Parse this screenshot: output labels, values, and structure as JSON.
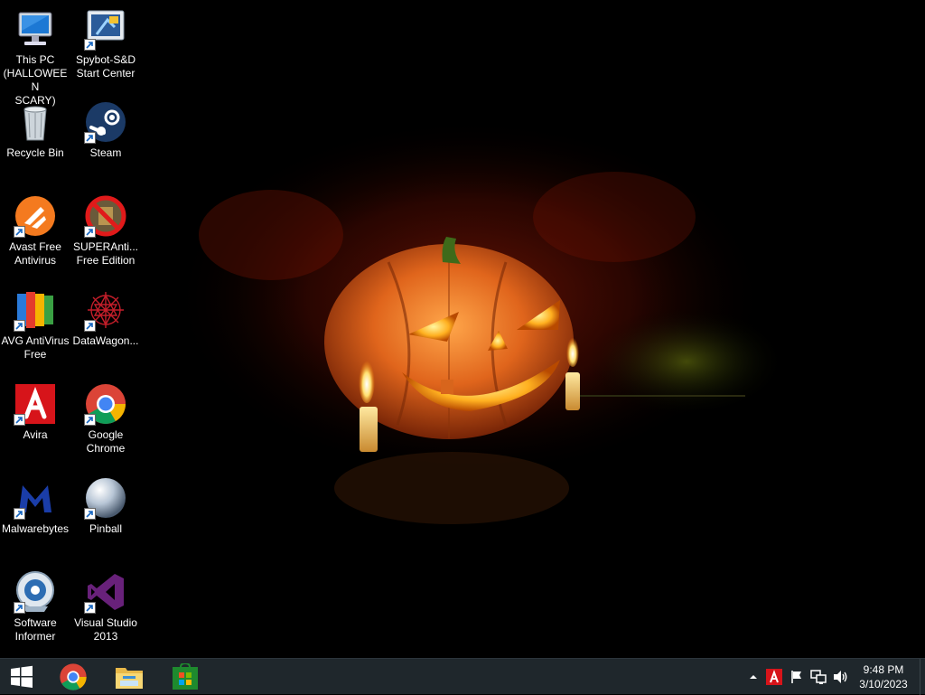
{
  "desktop": {
    "icons": [
      {
        "name": "this-pc",
        "label": "This PC\n(HALLOWEEN\nSCARY)",
        "icon": "computer-icon"
      },
      {
        "name": "spybot",
        "label": "Spybot-S&D\nStart Center",
        "icon": "spybot-icon"
      },
      {
        "name": "recycle-bin",
        "label": "Recycle Bin",
        "icon": "recycle-bin-icon"
      },
      {
        "name": "steam",
        "label": "Steam",
        "icon": "steam-icon"
      },
      {
        "name": "avast",
        "label": "Avast Free\nAntivirus",
        "icon": "avast-icon"
      },
      {
        "name": "superantispyware",
        "label": "SUPERAnti...\nFree Edition",
        "icon": "superantispyware-icon"
      },
      {
        "name": "avg",
        "label": "AVG AntiVirus\nFree",
        "icon": "avg-icon"
      },
      {
        "name": "datawagon",
        "label": "DataWagon...",
        "icon": "datawagon-icon"
      },
      {
        "name": "avira",
        "label": "Avira",
        "icon": "avira-icon"
      },
      {
        "name": "google-chrome",
        "label": "Google\nChrome",
        "icon": "chrome-icon"
      },
      {
        "name": "malwarebytes",
        "label": "Malwarebytes",
        "icon": "malwarebytes-icon"
      },
      {
        "name": "pinball",
        "label": "Pinball",
        "icon": "pinball-icon"
      },
      {
        "name": "software-informer",
        "label": "Software\nInformer",
        "icon": "software-informer-icon"
      },
      {
        "name": "visual-studio",
        "label": "Visual Studio\n2013",
        "icon": "visual-studio-icon"
      }
    ]
  },
  "taskbar": {
    "start": {
      "icon": "windows-logo-icon"
    },
    "pinned": [
      {
        "name": "chrome",
        "icon": "chrome-icon"
      },
      {
        "name": "file-explorer",
        "icon": "folder-icon"
      },
      {
        "name": "store",
        "icon": "store-icon"
      }
    ],
    "tray": {
      "icons": [
        "chevron-up-icon",
        "avira-tray-icon",
        "flag-icon",
        "network-icon",
        "volume-icon"
      ]
    },
    "clock": {
      "time": "9:48 PM",
      "date": "3/10/2023"
    }
  },
  "colors": {
    "taskbar_bg": "#1f272c",
    "pumpkin": "#e0651c",
    "accent_green": "#1e8a2e"
  }
}
